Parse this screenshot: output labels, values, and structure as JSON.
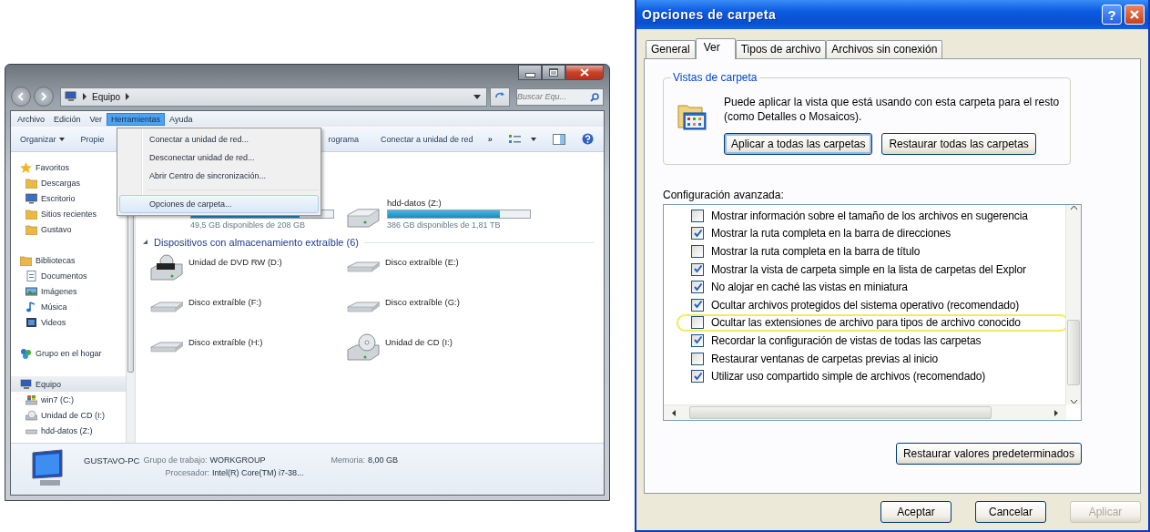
{
  "explorer": {
    "address": {
      "path": [
        "Equipo"
      ]
    },
    "search": {
      "placeholder": "Buscar Equ..."
    },
    "menu_bar": [
      {
        "label": "Archivo",
        "selected": false
      },
      {
        "label": "Edición",
        "selected": false
      },
      {
        "label": "Ver",
        "selected": false
      },
      {
        "label": "Herramientas",
        "selected": true
      },
      {
        "label": "Ayuda",
        "selected": false
      }
    ],
    "toolbar": [
      {
        "label": "Organizar",
        "kind": "dropdown"
      },
      {
        "label": "Propie",
        "kind": "button"
      },
      {
        "label": "rograma",
        "kind": "button"
      },
      {
        "label": "Conectar a unidad de red",
        "kind": "button"
      },
      {
        "label": "»",
        "kind": "overflow"
      }
    ],
    "open_menu": [
      {
        "kind": "item",
        "label": "Conectar a unidad de red...",
        "hovered": false
      },
      {
        "kind": "item",
        "label": "Desconectar unidad de red...",
        "hovered": false
      },
      {
        "kind": "item",
        "label": "Abrir Centro de sincronización...",
        "hovered": false
      },
      {
        "kind": "separator"
      },
      {
        "kind": "item",
        "label": "Opciones de carpeta...",
        "hovered": true
      }
    ],
    "nav": [
      {
        "label": "Favoritos",
        "kind": "star",
        "selected": false,
        "children": [
          {
            "label": "Descargas",
            "kind": "folder",
            "selected": false
          },
          {
            "label": "Escritorio",
            "kind": "monitor",
            "selected": false
          },
          {
            "label": "Sitios recientes",
            "kind": "folder",
            "selected": false
          },
          {
            "label": "Gustavo",
            "kind": "folder",
            "selected": false
          }
        ]
      },
      {
        "label": "Bibliotecas",
        "kind": "folder",
        "selected": false,
        "children": [
          {
            "label": "Documentos",
            "kind": "document",
            "selected": false
          },
          {
            "label": "Imágenes",
            "kind": "picture",
            "selected": false
          },
          {
            "label": "Música",
            "kind": "music",
            "selected": false
          },
          {
            "label": "Videos",
            "kind": "video",
            "selected": false
          }
        ]
      },
      {
        "label": "Grupo en el hogar",
        "kind": "homegroup",
        "selected": false
      },
      {
        "label": "Equipo",
        "kind": "computer",
        "selected": true,
        "children": [
          {
            "label": "win7 (C:)",
            "kind": "system-drive",
            "selected": false
          },
          {
            "label": "Unidad de CD (I:)",
            "kind": "cd",
            "selected": false
          },
          {
            "label": "hdd-datos (Z:)",
            "kind": "drive",
            "selected": false
          }
        ]
      }
    ],
    "drives": [
      {
        "free": "49,5 GB disponibles de 208 GB",
        "level": 0.76
      },
      {
        "name": "hdd-datos (Z:)",
        "free": "386 GB disponibles de 1,81 TB",
        "level": 0.79
      }
    ],
    "section": "Dispositivos con almacenamiento extraíble (6)",
    "devices": [
      {
        "label": "Unidad de DVD RW (D:)",
        "kind": "dvd"
      },
      {
        "label": "Disco extraíble (E:)",
        "kind": "removable"
      },
      {
        "label": "Disco extraíble (F:)",
        "kind": "removable"
      },
      {
        "label": "Disco extraíble (G:)",
        "kind": "removable"
      },
      {
        "label": "Disco extraíble (H:)",
        "kind": "removable"
      },
      {
        "label": "Unidad de CD (I:)",
        "kind": "cd"
      }
    ],
    "details": {
      "name": "GUSTAVO-PC",
      "fields": [
        {
          "label": "Grupo de trabajo:",
          "value": "WORKGROUP"
        },
        {
          "label": "Memoria:",
          "value": "8,00 GB"
        },
        {
          "label": "Procesador:",
          "value": "Intel(R) Core(TM) i7-38..."
        }
      ]
    }
  },
  "dialog": {
    "title": "Opciones de carpeta",
    "help_button": "?",
    "tabs": [
      {
        "label": "General",
        "selected": false
      },
      {
        "label": "Ver",
        "selected": true
      },
      {
        "label": "Tipos de archivo",
        "selected": false
      },
      {
        "label": "Archivos sin conexión",
        "selected": false
      }
    ],
    "folder_views": {
      "title": "Vistas de carpeta",
      "text": "Puede aplicar la vista que está usando con esta carpeta para el resto (como Detalles o Mosaicos).",
      "buttons": [
        {
          "label": "Aplicar a todas las carpetas",
          "focused": true
        },
        {
          "label": "Restaurar todas las carpetas",
          "focused": false
        }
      ]
    },
    "advanced": {
      "label": "Configuración avanzada:",
      "items": [
        {
          "label": "Mostrar información sobre el tamaño de los archivos en sugerencia",
          "checked": false,
          "highlighted": false
        },
        {
          "label": "Mostrar la ruta completa en la barra de direcciones",
          "checked": true,
          "highlighted": false
        },
        {
          "label": "Mostrar la ruta completa en la barra de título",
          "checked": false,
          "highlighted": false
        },
        {
          "label": "Mostrar la vista de carpeta simple en la lista de carpetas del Explor",
          "checked": true,
          "highlighted": false
        },
        {
          "label": "No alojar en caché las vistas en miniatura",
          "checked": true,
          "highlighted": false
        },
        {
          "label": "Ocultar archivos protegidos del sistema operativo (recomendado)",
          "checked": true,
          "highlighted": false
        },
        {
          "label": "Ocultar las extensiones de archivo para tipos de archivo conocido",
          "checked": false,
          "highlighted": true
        },
        {
          "label": "Recordar la configuración de vistas de todas las carpetas",
          "checked": true,
          "highlighted": false
        },
        {
          "label": "Restaurar ventanas de carpetas previas al inicio",
          "checked": false,
          "highlighted": false
        },
        {
          "label": "Utilizar uso compartido simple de archivos (recomendado)",
          "checked": true,
          "highlighted": false
        }
      ]
    },
    "restore_button": "Restaurar valores predeterminados",
    "buttons": [
      {
        "label": "Aceptar",
        "disabled": false
      },
      {
        "label": "Cancelar",
        "disabled": false
      },
      {
        "label": "Aplicar",
        "disabled": true
      }
    ]
  }
}
